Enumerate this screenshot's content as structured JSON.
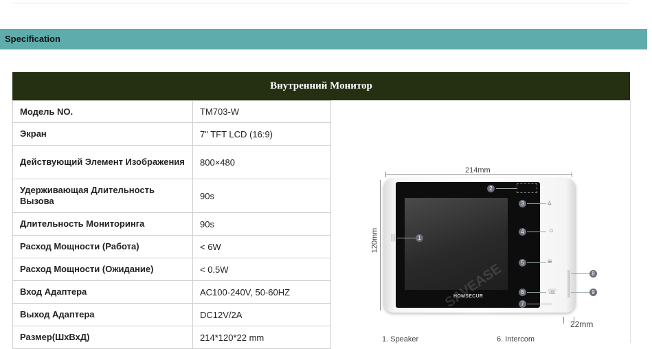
{
  "section_title": "Specification",
  "table_title": "Внутренний Монитор",
  "rows": [
    {
      "key": "Модель NO.",
      "value": "TM703-W"
    },
    {
      "key": "Экран",
      "value": "7\" TFT LCD (16:9)"
    },
    {
      "key": "Действующий Элемент Изображения",
      "value": "800×480"
    },
    {
      "key": "Удерживающая Длительность Вызова",
      "value": "90s"
    },
    {
      "key": "Длительность Мониторинга",
      "value": "90s"
    },
    {
      "key": "Расход Мощности (Работа)",
      "value": "< 6W"
    },
    {
      "key": "Расход Мощности (Ожидание)",
      "value": "< 0.5W"
    },
    {
      "key": "Вход Адаптера",
      "value": "AC100-240V, 50-60HZ"
    },
    {
      "key": "Выход Адаптера",
      "value": "DC12V/2A"
    },
    {
      "key": "Размер(ШхВхД)",
      "value": "214*120*22 mm"
    }
  ],
  "diagram": {
    "width_label": "214mm",
    "height_label": "120mm",
    "depth_label": "22mm",
    "brand": "HOMSECUR",
    "watermark": "SAVEASE",
    "markers": [
      "1",
      "2",
      "3",
      "4",
      "5",
      "6",
      "7",
      "8",
      "9"
    ],
    "legend_1": "1. Speaker",
    "legend_6": "6. Intercom"
  }
}
